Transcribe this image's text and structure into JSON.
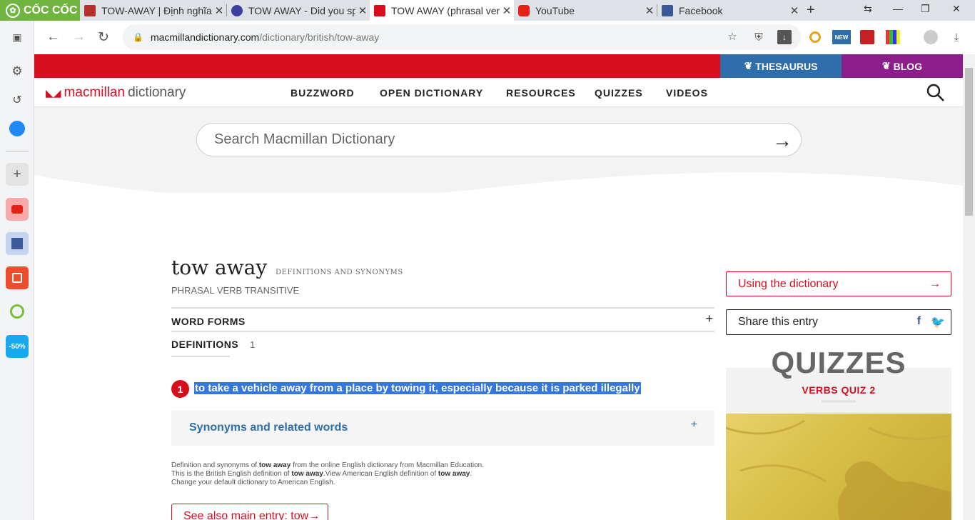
{
  "browser": {
    "brand": "CỐC CỐC",
    "tabs": [
      {
        "title": "TOW-AWAY | Định nghĩa",
        "favicon": "cambridge-icon"
      },
      {
        "title": "TOW AWAY - Did you sp",
        "favicon": "globe-icon"
      },
      {
        "title": "TOW AWAY (phrasal ver",
        "favicon": "macmillan-icon"
      },
      {
        "title": "YouTube",
        "favicon": "youtube-icon"
      },
      {
        "title": "Facebook",
        "favicon": "facebook-icon"
      }
    ],
    "url_host": "macmillandictionary.com",
    "url_path": "/dictionary/british/tow-away",
    "ext_badge": "NEW"
  },
  "site": {
    "top_links": {
      "thesaurus": "THESAURUS",
      "blog": "BLOG"
    },
    "logo": {
      "brand": "macmillan",
      "suffix": "dictionary"
    },
    "menu": [
      "BUZZWORD",
      "OPEN DICTIONARY",
      "RESOURCES",
      "QUIZZES",
      "VIDEOS"
    ],
    "search_placeholder": "Search Macmillan Dictionary"
  },
  "entry": {
    "headword": "tow away",
    "headword_sub": "DEFINITIONS AND SYNONYMS",
    "pos": "PHRASAL VERB  TRANSITIVE",
    "word_forms": "WORD FORMS",
    "definitions_label": "DEFINITIONS",
    "definitions_count": "1",
    "def_number": "1",
    "definition": "to take a vehicle away from a place by towing it, especially because it is parked illegally",
    "synonyms": "Synonyms and related words",
    "footer": {
      "l1a": "Definition and synonyms of ",
      "l1b": "tow away",
      "l1c": " from the online English dictionary from Macmillan Education.",
      "l2a": "This is the British English definition of ",
      "l2b": "tow away",
      "l2c": ".View American English definition of ",
      "l2d": "tow away",
      "l2e": ".",
      "l3": "Change your default dictionary to American English."
    },
    "see_also": "See also main entry: tow→"
  },
  "sidebar_right": {
    "using": "Using the dictionary",
    "share": "Share this entry",
    "quiz_title": "QUIZZES",
    "quiz_sub": "VERBS QUIZ 2"
  },
  "colors": {
    "accent": "#d80e1f",
    "thesaurus": "#2f6eab",
    "blog": "#8b1e8b",
    "selection": "#3478dd"
  }
}
